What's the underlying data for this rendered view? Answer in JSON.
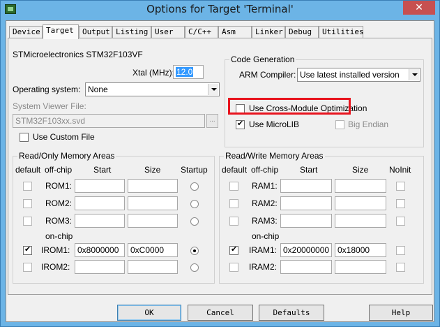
{
  "window": {
    "title": "Options for Target 'Terminal'",
    "close_glyph": "✕"
  },
  "tabs": [
    "Device",
    "Target",
    "Output",
    "Listing",
    "User",
    "C/C++",
    "Asm",
    "Linker",
    "Debug",
    "Utilities"
  ],
  "active_tab": "Target",
  "device": {
    "name": "STMicroelectronics STM32F103VF"
  },
  "xtal": {
    "label": "Xtal (MHz):",
    "value": "12.0"
  },
  "os": {
    "label": "Operating system:",
    "value": "None"
  },
  "svd": {
    "label": "System Viewer File:",
    "value": "STM32F103xx.svd",
    "browse": "..."
  },
  "custom_file": {
    "label": "Use Custom File",
    "checked": false
  },
  "codegen": {
    "title": "Code Generation",
    "compiler_label": "ARM Compiler:",
    "compiler_value": "Use latest installed version",
    "cross_module": {
      "label": "Use Cross-Module Optimization",
      "checked": false
    },
    "microlib": {
      "label": "Use MicroLIB",
      "checked": true
    },
    "big_endian": {
      "label": "Big Endian",
      "checked": false
    }
  },
  "rom_group": {
    "title": "Read/Only Memory Areas",
    "headers": {
      "default": "default",
      "offchip": "off-chip",
      "start": "Start",
      "size": "Size",
      "startup": "Startup"
    },
    "onchip_label": "on-chip",
    "rows": [
      {
        "name": "ROM1:",
        "default": false,
        "start": "",
        "size": "",
        "startup": false
      },
      {
        "name": "ROM2:",
        "default": false,
        "start": "",
        "size": "",
        "startup": false
      },
      {
        "name": "ROM3:",
        "default": false,
        "start": "",
        "size": "",
        "startup": false
      },
      {
        "name": "IROM1:",
        "default": true,
        "start": "0x8000000",
        "size": "0xC0000",
        "startup": true
      },
      {
        "name": "IROM2:",
        "default": false,
        "start": "",
        "size": "",
        "startup": false
      }
    ]
  },
  "ram_group": {
    "title": "Read/Write Memory Areas",
    "headers": {
      "default": "default",
      "offchip": "off-chip",
      "start": "Start",
      "size": "Size",
      "noinit": "NoInit"
    },
    "onchip_label": "on-chip",
    "rows": [
      {
        "name": "RAM1:",
        "default": false,
        "start": "",
        "size": "",
        "noinit": false
      },
      {
        "name": "RAM2:",
        "default": false,
        "start": "",
        "size": "",
        "noinit": false
      },
      {
        "name": "RAM3:",
        "default": false,
        "start": "",
        "size": "",
        "noinit": false
      },
      {
        "name": "IRAM1:",
        "default": true,
        "start": "0x20000000",
        "size": "0x18000",
        "noinit": false
      },
      {
        "name": "IRAM2:",
        "default": false,
        "start": "",
        "size": "",
        "noinit": false
      }
    ]
  },
  "buttons": {
    "ok": "OK",
    "cancel": "Cancel",
    "defaults": "Defaults",
    "help": "Help"
  }
}
